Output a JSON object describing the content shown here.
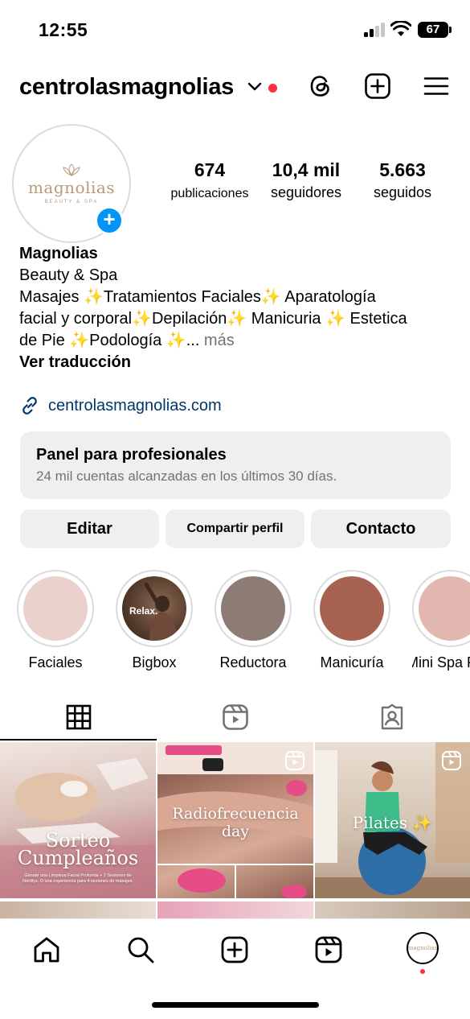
{
  "status_bar": {
    "time": "12:55",
    "battery": "67"
  },
  "header": {
    "username": "centrolasmagnolias",
    "icons": [
      "chevron-down-icon",
      "threads-icon",
      "new-post-icon",
      "menu-icon"
    ]
  },
  "profile": {
    "avatar_logo": {
      "word": "magnolias",
      "sub": "BEAUTY & SPA"
    },
    "stats": [
      {
        "value": "674",
        "label": "publicaciones"
      },
      {
        "value": "10,4 mil",
        "label": "seguidores"
      },
      {
        "value": "5.663",
        "label": "seguidos"
      }
    ],
    "name": "Magnolias",
    "category": "Beauty & Spa",
    "bio_line1": "Masajes ✨Tratamientos Faciales✨ Aparatología",
    "bio_line2": "facial y corporal✨Depilación✨ Manicuria ✨ Estetica",
    "bio_line3": "de Pie ✨Podología ✨...",
    "more": " más",
    "translate": "Ver traducción",
    "link": "centrolasmagnolias.com"
  },
  "dashboard": {
    "title": "Panel para profesionales",
    "subtitle": "24 mil cuentas alcanzadas en los últimos 30 días."
  },
  "buttons": {
    "edit": "Editar",
    "share": "Compartir perfil",
    "contact": "Contacto"
  },
  "highlights": [
    {
      "label": "Faciales",
      "color": "#ead1cb"
    },
    {
      "label": "Bigbox",
      "color": "#5a3e2e",
      "text": "Relax."
    },
    {
      "label": "Reductora",
      "color": "#8c7c73"
    },
    {
      "label": "Manicuría",
      "color": "#a86252"
    },
    {
      "label": "Mini Spa P",
      "color": "#e1b7af"
    }
  ],
  "posts": [
    {
      "title_a": "Sorteo",
      "title_b": "Cumpleaños",
      "caption": "Gánate una Limpieza Facial Profunda + 2 Sesiones de Nordlys. O una experiencia para 4 sesiones de masajes."
    },
    {
      "title_a": "Radiofrecuencia",
      "title_b": "day"
    },
    {
      "title_a": "Pilates ✨"
    }
  ],
  "colors": {
    "accent": "#0095f6",
    "notification": "#ff3040",
    "link": "#00376b"
  }
}
